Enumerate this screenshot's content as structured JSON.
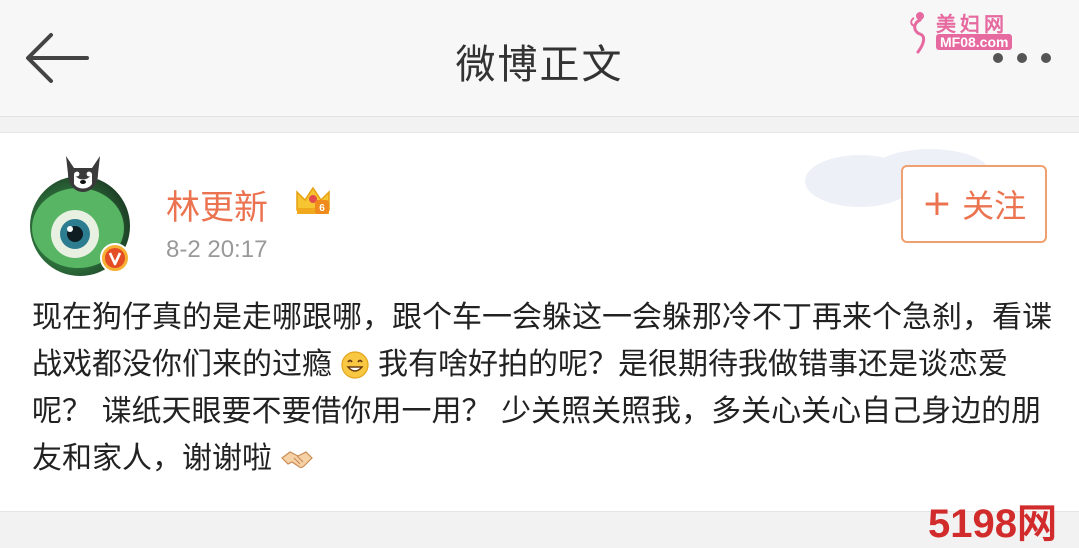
{
  "header": {
    "title": "微博正文",
    "back_icon": "arrow-left-icon",
    "more_icon": "more-dots-icon"
  },
  "watermark_top": {
    "name": "美妇网",
    "domain": "MF08.com"
  },
  "post": {
    "username": "林更新",
    "badge_icon": "vip-crown-icon",
    "verified_icon": "verified-v-icon",
    "timestamp": "8-2 20:17",
    "follow_label": "关注",
    "follow_plus": "+",
    "text_part1": "现在狗仔真的是走哪跟哪，跟个车一会躲这一会躲那冷不丁再来个急刹，看谍战戏都没你们来的过瘾",
    "text_part2": "我有啥好拍的呢？是很期待我做错事还是谈恋爱呢？ 谍纸天眼要不要借你用一用？ 少关照关照我，多关心关心自己身边的朋友和家人，谢谢啦",
    "emoji_1": "grin-emoji",
    "emoji_2": "handshake-emoji"
  },
  "watermark_bottom": "5198网",
  "colors": {
    "accent": "#eb7350",
    "title": "#333333",
    "time": "#999999",
    "watermark_red": "#d22b2b"
  }
}
